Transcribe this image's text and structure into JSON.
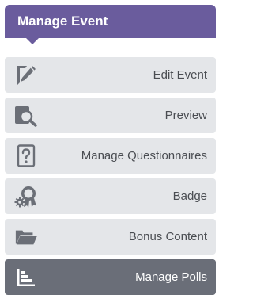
{
  "header": {
    "title": "Manage Event"
  },
  "menu": {
    "items": [
      {
        "label": "Edit Event",
        "icon": "edit-icon"
      },
      {
        "label": "Preview",
        "icon": "preview-icon"
      },
      {
        "label": "Manage Questionnaires",
        "icon": "questionnaire-icon"
      },
      {
        "label": "Badge",
        "icon": "badge-icon"
      },
      {
        "label": "Bonus Content",
        "icon": "folder-icon"
      },
      {
        "label": "Manage Polls",
        "icon": "polls-icon",
        "active": true
      }
    ]
  },
  "colors": {
    "header_bg": "#6a5c9d",
    "item_bg": "#e4e6e9",
    "active_bg": "#6a6e78",
    "icon": "#6b6f77",
    "text": "#4a4d52"
  }
}
